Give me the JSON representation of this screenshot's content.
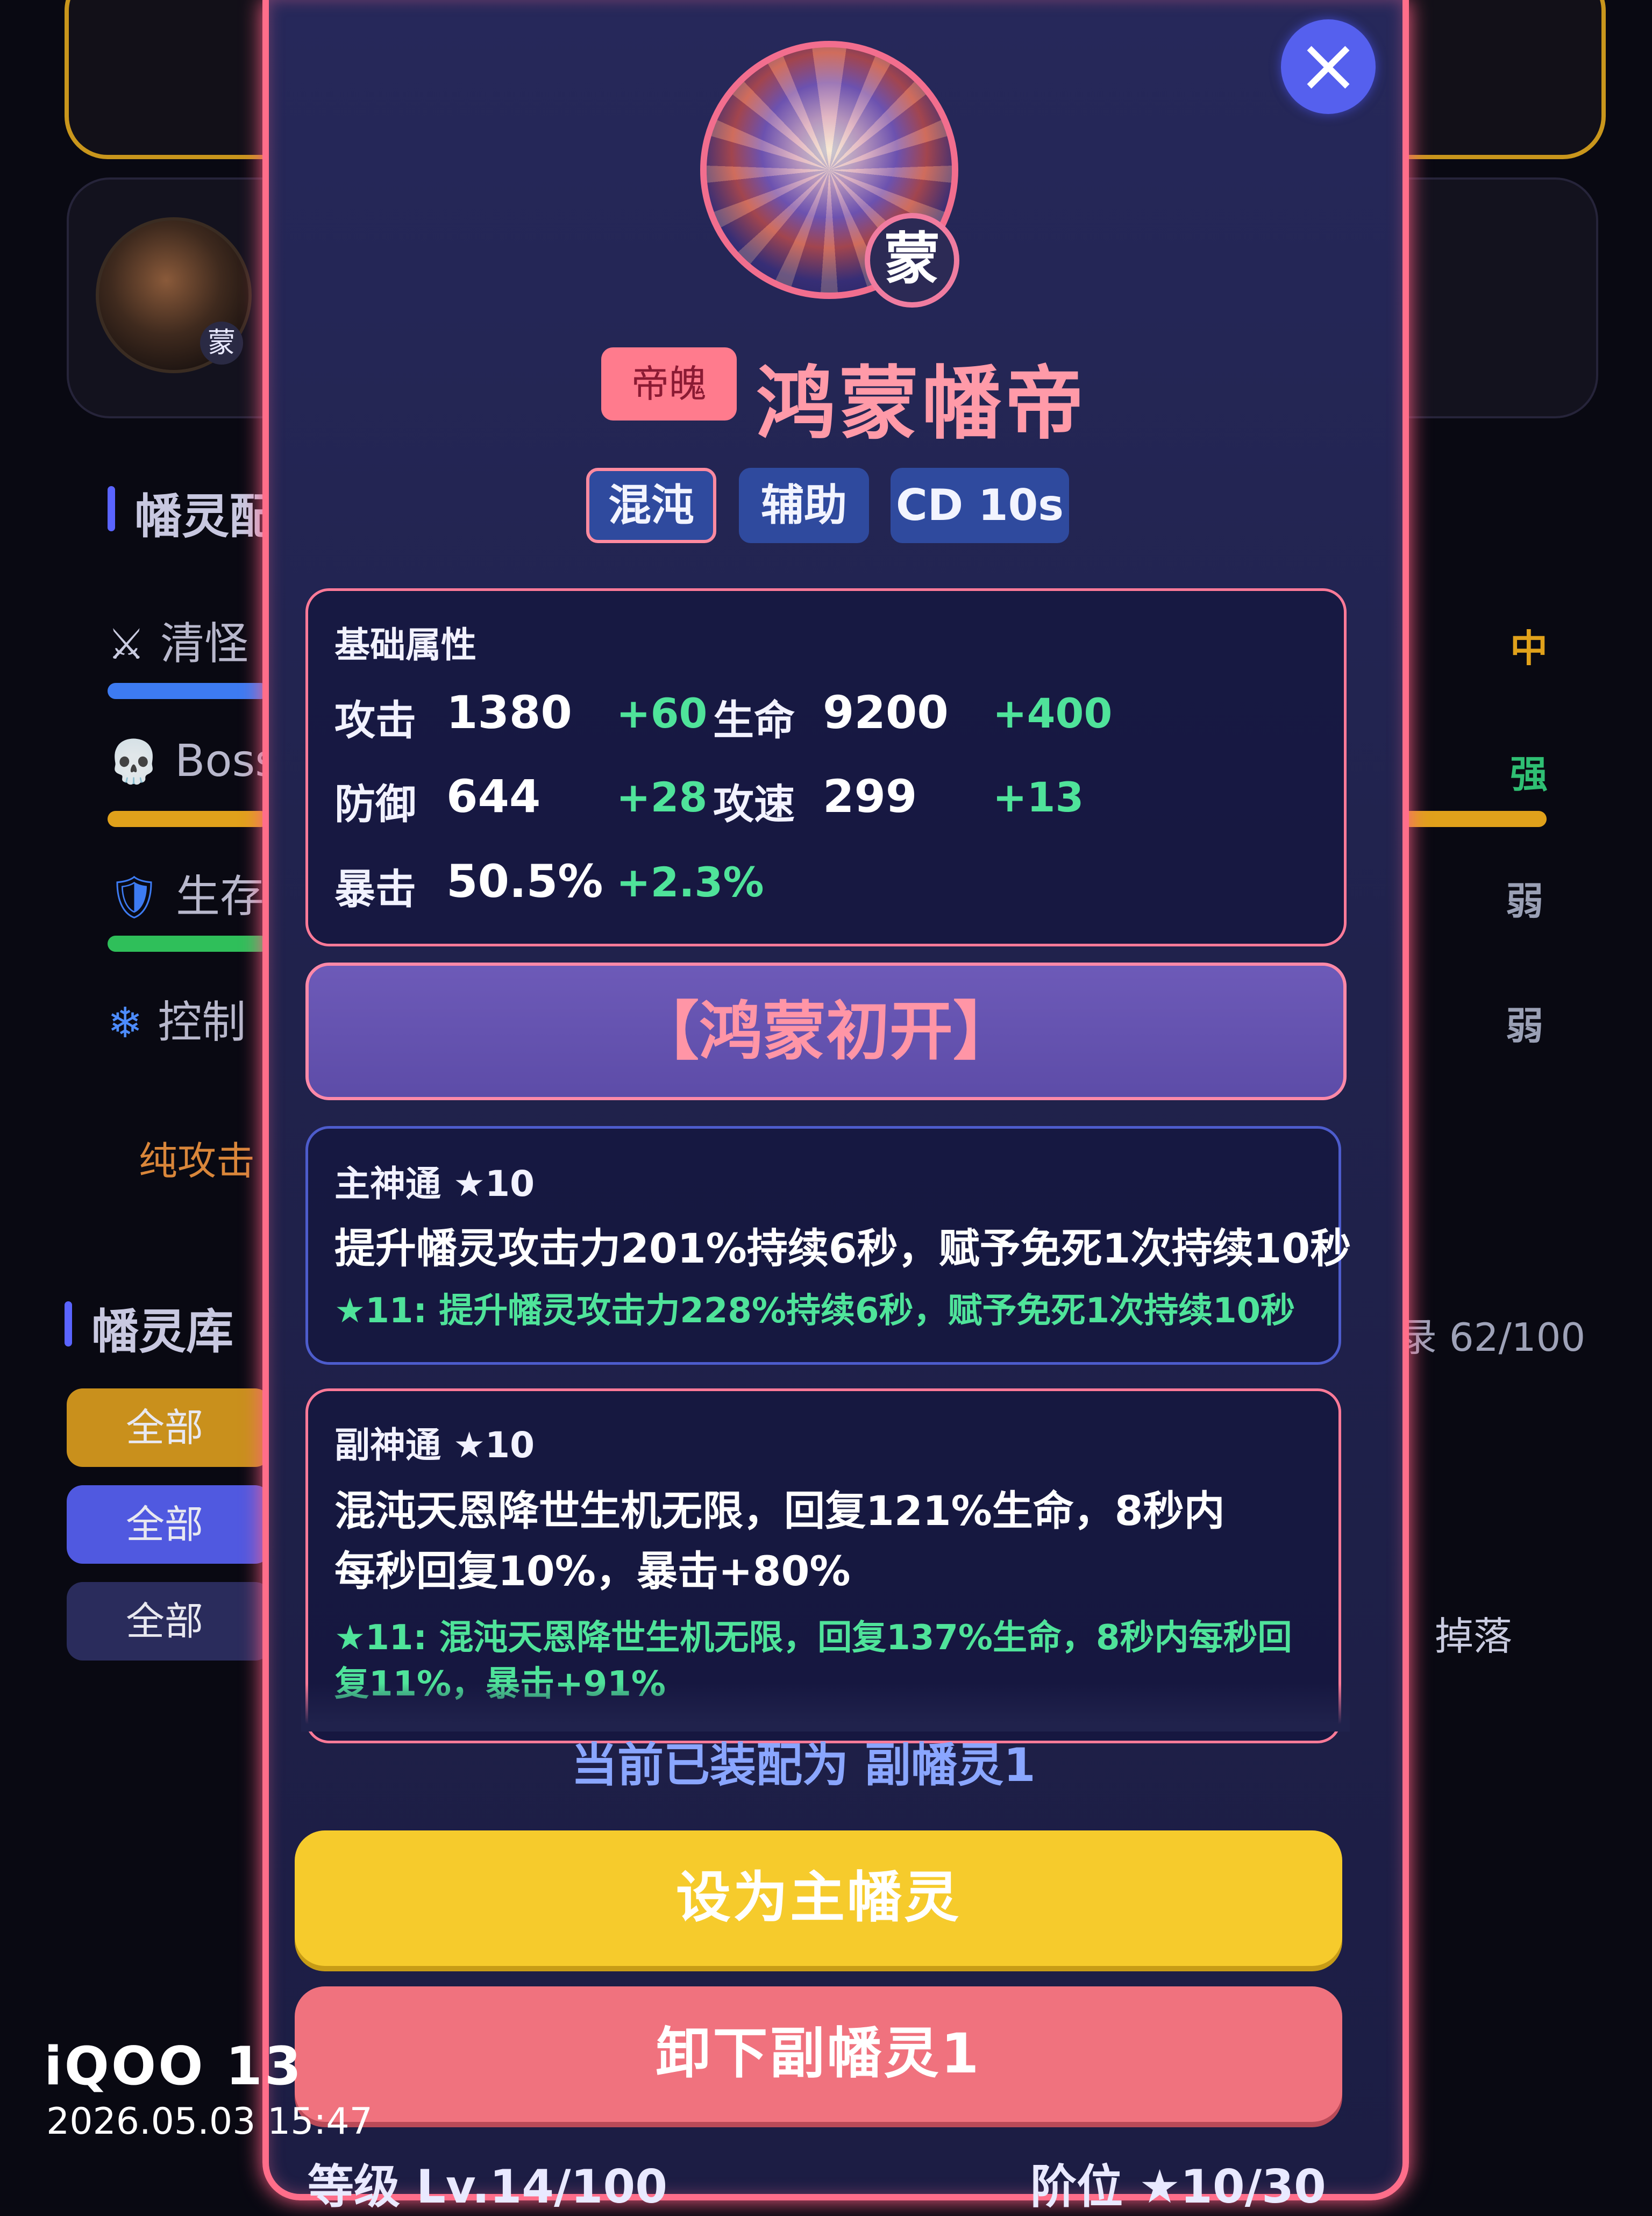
{
  "background": {
    "section_lineup_title": "幡灵配",
    "stats": [
      {
        "icon": "swords-icon",
        "glyph": "⚔",
        "label": "清怪",
        "rating": "中",
        "rating_color": "#e0a11b",
        "bar_color": "#3d7bf2"
      },
      {
        "icon": "skull-icon",
        "glyph": "💀",
        "label": "Boss",
        "rating": "强",
        "rating_color": "#2fbf73",
        "bar_color": "#e0a11b"
      },
      {
        "icon": "shield-icon",
        "glyph": "🛡",
        "label": "生存",
        "rating": "弱",
        "rating_color": "#9aa0b5",
        "bar_color": "#2fbf5a"
      },
      {
        "icon": "snowflake-icon",
        "glyph": "❄",
        "label": "控制",
        "rating": "弱",
        "rating_color": "#9aa0b5",
        "bar_color": "#3d7bf2"
      }
    ],
    "note": "纯攻击",
    "section_library_title": "幡灵库",
    "collection_count": "录 62/100",
    "filters": [
      "全部",
      "全部",
      "全部"
    ],
    "drop_label": "掉落",
    "avatar_badge": "蒙"
  },
  "modal": {
    "close_icon": "close-icon",
    "portrait_badge": "蒙",
    "rank_badge": "帝魄",
    "name": "鸿蒙幡帝",
    "tags": [
      "混沌",
      "辅助",
      "CD 10s"
    ],
    "base_stats": {
      "title": "基础属性",
      "rows": [
        [
          {
            "label": "攻击",
            "value": "1380",
            "bonus": "+60"
          },
          {
            "label": "生命",
            "value": "9200",
            "bonus": "+400"
          }
        ],
        [
          {
            "label": "防御",
            "value": "644",
            "bonus": "+28"
          },
          {
            "label": "攻速",
            "value": "299",
            "bonus": "+13"
          }
        ],
        [
          {
            "label": "暴击",
            "value": "50.5%",
            "bonus": "+2.3%"
          }
        ]
      ]
    },
    "skill_banner": "【鸿蒙初开】",
    "main_skill": {
      "title": "主神通 ★10",
      "desc": "提升幡灵攻击力201%持续6秒，赋予免死1次持续10秒",
      "next": "★11: 提升幡灵攻击力228%持续6秒，赋予免死1次持续10秒"
    },
    "sub_skill": {
      "title": "副神通 ★10",
      "desc_line1": "混沌天恩降世生机无限，回复121%生命，8秒内",
      "desc_line2": "每秒回复10%，暴击+80%",
      "next_line1": "★11: 混沌天恩降世生机无限，回复137%生命，8秒内每秒回",
      "next_line2": "复11%，暴击+91%"
    },
    "equipped_text": "当前已装配为  副幡灵1",
    "primary_button": "设为主幡灵",
    "unequip_button": "卸下副幡灵1",
    "level_label": "等级 Lv.14/100",
    "stage_label": "阶位 ★10/30"
  },
  "watermark": {
    "brand": "iQOO 13",
    "timestamp": "2026.05.03 15:47"
  }
}
